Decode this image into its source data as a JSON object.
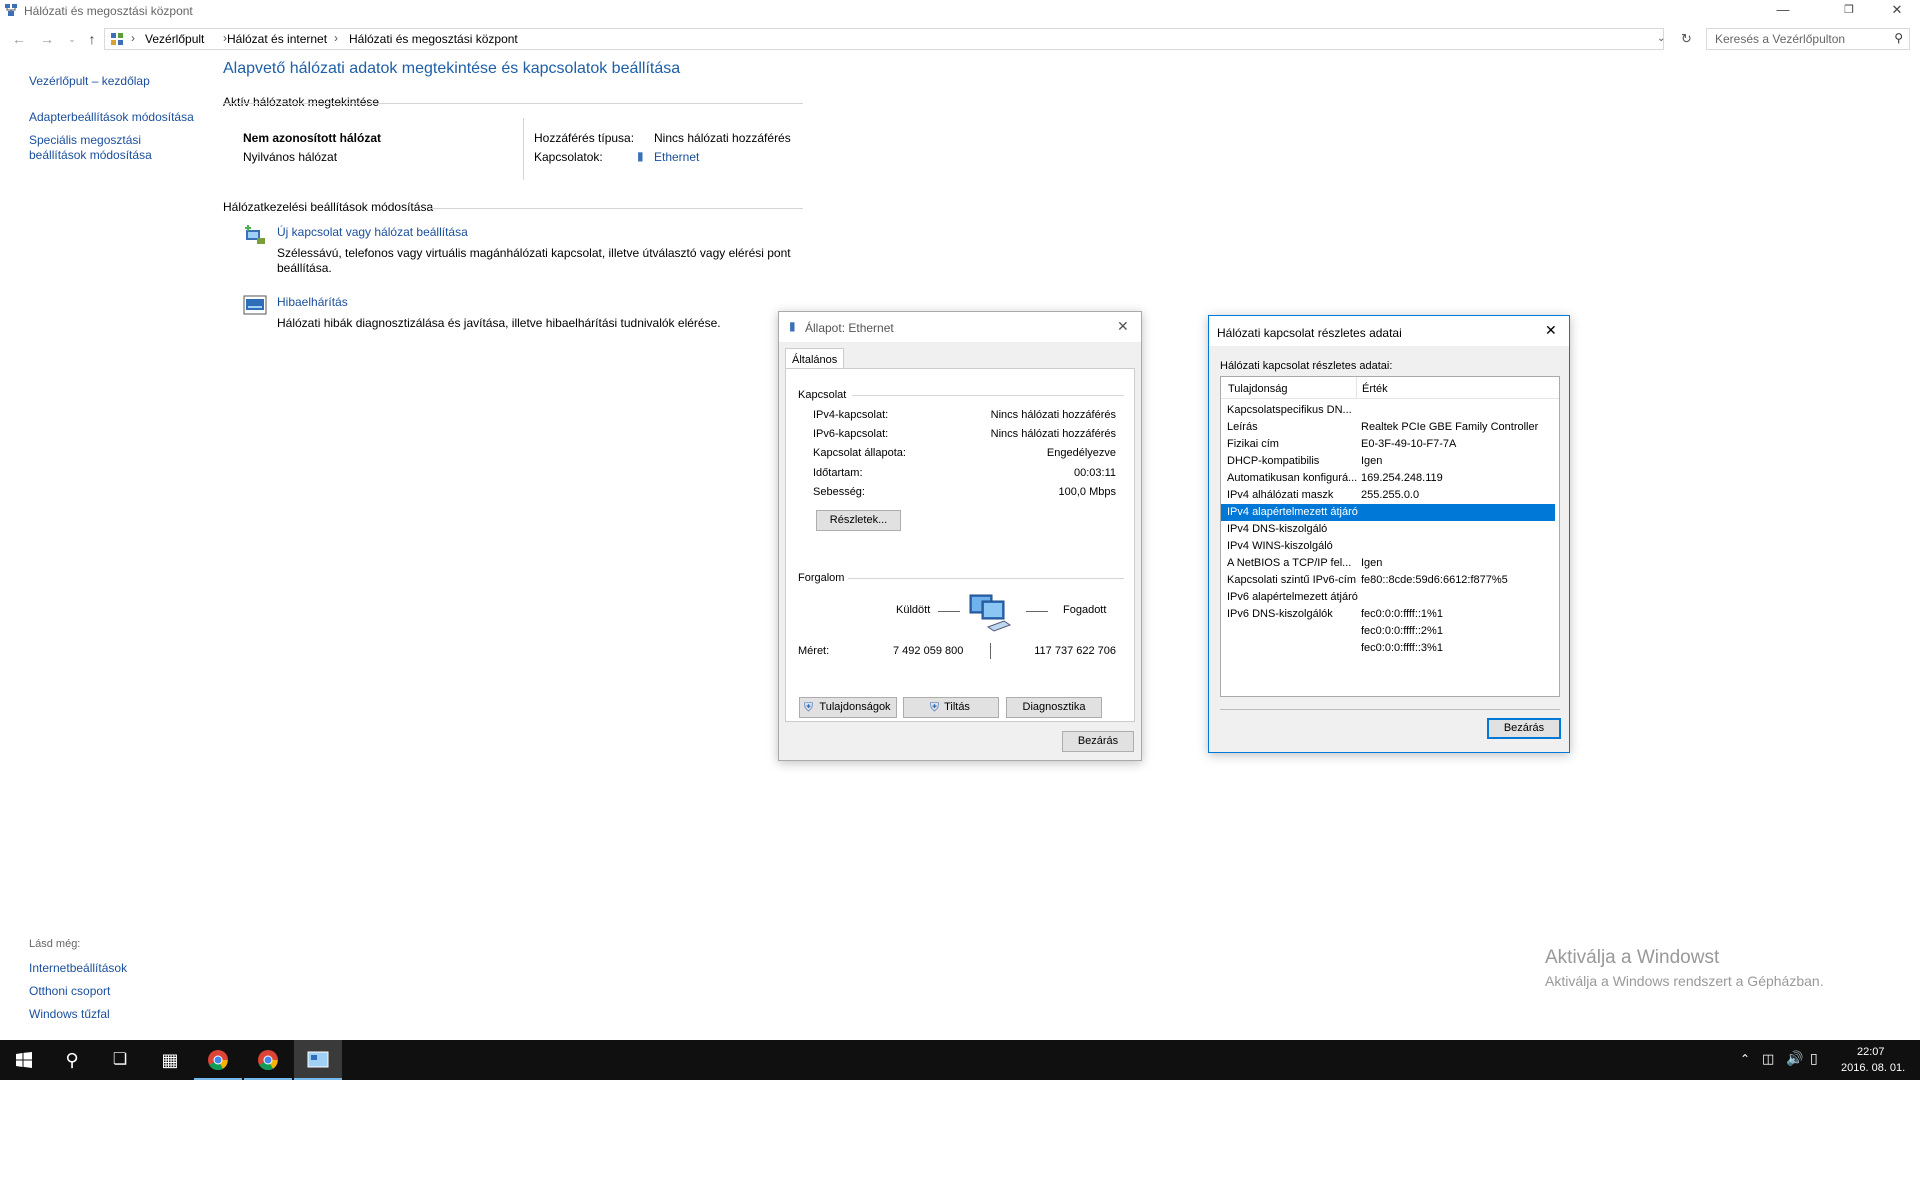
{
  "window": {
    "title": "Hálózati és megosztási központ",
    "breadcrumb": [
      "Vezérlőpult",
      "Hálózat és internet",
      "Hálózati és megosztási központ"
    ],
    "search_placeholder": "Keresés a Vezérlőpulton"
  },
  "sidebar": {
    "items": [
      "Vezérlőpult – kezdőlap",
      "Adapterbeállítások módosítása",
      "Speciális megosztási",
      "beállítások módosítása"
    ],
    "see_also_label": "Lásd még:",
    "see_also": [
      "Internetbeállítások",
      "Otthoni csoport",
      "Windows tűzfal"
    ]
  },
  "main": {
    "heading": "Alapvető hálózati adatok megtekintése és kapcsolatok beállítása",
    "active_section": "Aktív hálózatok megtekintése",
    "network_name": "Nem azonosított hálózat",
    "network_type": "Nyilvános hálózat",
    "access_label": "Hozzáférés típusa:",
    "access_value": "Nincs hálózati hozzáférés",
    "connections_label": "Kapcsolatok:",
    "connections_value": "Ethernet",
    "change_section": "Hálózatkezelési beállítások módosítása",
    "new_conn_link": "Új kapcsolat vagy hálózat beállítása",
    "new_conn_desc1": "Szélessávú, telefonos vagy virtuális magánhálózati kapcsolat, illetve útválasztó vagy elérési pont",
    "new_conn_desc2": "beállítása.",
    "troubleshoot_link": "Hibaelhárítás",
    "troubleshoot_desc": "Hálózati hibák diagnosztizálása és javítása, illetve hibaelhárítási tudnivalók elérése."
  },
  "status_dialog": {
    "title": "Állapot: Ethernet",
    "tab": "Általános",
    "connection_group": "Kapcsolat",
    "rows": [
      {
        "label": "IPv4-kapcsolat:",
        "value": "Nincs hálózati hozzáférés"
      },
      {
        "label": "IPv6-kapcsolat:",
        "value": "Nincs hálózati hozzáférés"
      },
      {
        "label": "Kapcsolat állapota:",
        "value": "Engedélyezve"
      },
      {
        "label": "Időtartam:",
        "value": "00:03:11"
      },
      {
        "label": "Sebesség:",
        "value": "100,0 Mbps"
      }
    ],
    "details_btn": "Részletek...",
    "activity_group": "Forgalom",
    "sent_label": "Küldött",
    "received_label": "Fogadott",
    "bytes_label": "Méret:",
    "bytes_sent": "7 492 059 800",
    "bytes_received": "117 737 622 706",
    "properties_btn": "Tulajdonságok",
    "disable_btn": "Tiltás",
    "diagnose_btn": "Diagnosztika",
    "close_btn": "Bezárás"
  },
  "details_dialog": {
    "title": "Hálózati kapcsolat részletes adatai",
    "label": "Hálózati kapcsolat részletes adatai:",
    "col_property": "Tulajdonság",
    "col_value": "Érték",
    "rows": [
      {
        "p": "Kapcsolatspecifikus DN...",
        "v": ""
      },
      {
        "p": "Leírás",
        "v": "Realtek PCIe GBE Family Controller"
      },
      {
        "p": "Fizikai cím",
        "v": "E0-3F-49-10-F7-7A"
      },
      {
        "p": "DHCP-kompatibilis",
        "v": "Igen"
      },
      {
        "p": "Automatikusan konfigurá...",
        "v": "169.254.248.119"
      },
      {
        "p": "IPv4 alhálózati maszk",
        "v": "255.255.0.0"
      },
      {
        "p": "IPv4 alapértelmezett átjáró",
        "v": ""
      },
      {
        "p": "IPv4 DNS-kiszolgáló",
        "v": ""
      },
      {
        "p": "IPv4 WINS-kiszolgáló",
        "v": ""
      },
      {
        "p": "A NetBIOS a TCP/IP fel...",
        "v": "Igen"
      },
      {
        "p": "Kapcsolati szintű IPv6-cím",
        "v": "fe80::8cde:59d6:6612:f877%5"
      },
      {
        "p": "IPv6 alapértelmezett átjáró",
        "v": ""
      },
      {
        "p": "IPv6 DNS-kiszolgálók",
        "v": "fec0:0:0:ffff::1%1"
      },
      {
        "p": "",
        "v": "fec0:0:0:ffff::2%1"
      },
      {
        "p": "",
        "v": "fec0:0:0:ffff::3%1"
      }
    ],
    "selected_index": 6,
    "close_btn": "Bezárás"
  },
  "watermark": {
    "line1": "Aktiválja a Windowst",
    "line2": "Aktiválja a Windows rendszert a Gépházban."
  },
  "taskbar": {
    "time": "22:07",
    "date": "2016. 08. 01."
  },
  "colors": {
    "accent": "#0078d7",
    "link": "#1a4f9c",
    "heading": "#1e5fa8",
    "taskbar": "#101010"
  }
}
